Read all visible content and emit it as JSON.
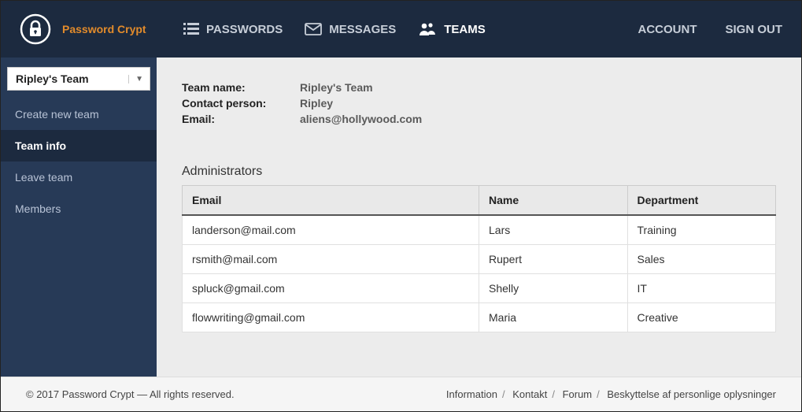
{
  "brand": {
    "title": "Password Crypt"
  },
  "nav": {
    "passwords": "PASSWORDS",
    "messages": "MESSAGES",
    "teams": "TEAMS"
  },
  "account": {
    "account": "ACCOUNT",
    "sign_out": "SIGN OUT"
  },
  "sidebar": {
    "selected_team": "Ripley's Team",
    "items": {
      "create": "Create new team",
      "info": "Team info",
      "leave": "Leave team",
      "members": "Members"
    }
  },
  "team": {
    "labels": {
      "name": "Team name:",
      "contact": "Contact person:",
      "email": "Email:"
    },
    "name": "Ripley's Team",
    "contact": "Ripley",
    "email": "aliens@hollywood.com"
  },
  "admins": {
    "title": "Administrators",
    "headers": {
      "email": "Email",
      "name": "Name",
      "dept": "Department"
    },
    "rows": [
      {
        "email": "landerson@mail.com",
        "name": "Lars",
        "dept": "Training"
      },
      {
        "email": "rsmith@mail.com",
        "name": "Rupert",
        "dept": "Sales"
      },
      {
        "email": "spluck@gmail.com",
        "name": "Shelly",
        "dept": "IT"
      },
      {
        "email": "flowwriting@gmail.com",
        "name": "Maria",
        "dept": "Creative"
      }
    ]
  },
  "footer": {
    "copyright": "© 2017 Password Crypt — All rights reserved.",
    "links": {
      "info": "Information",
      "contact": "Kontakt",
      "forum": "Forum",
      "privacy": "Beskyttelse af personlige oplysninger"
    }
  }
}
